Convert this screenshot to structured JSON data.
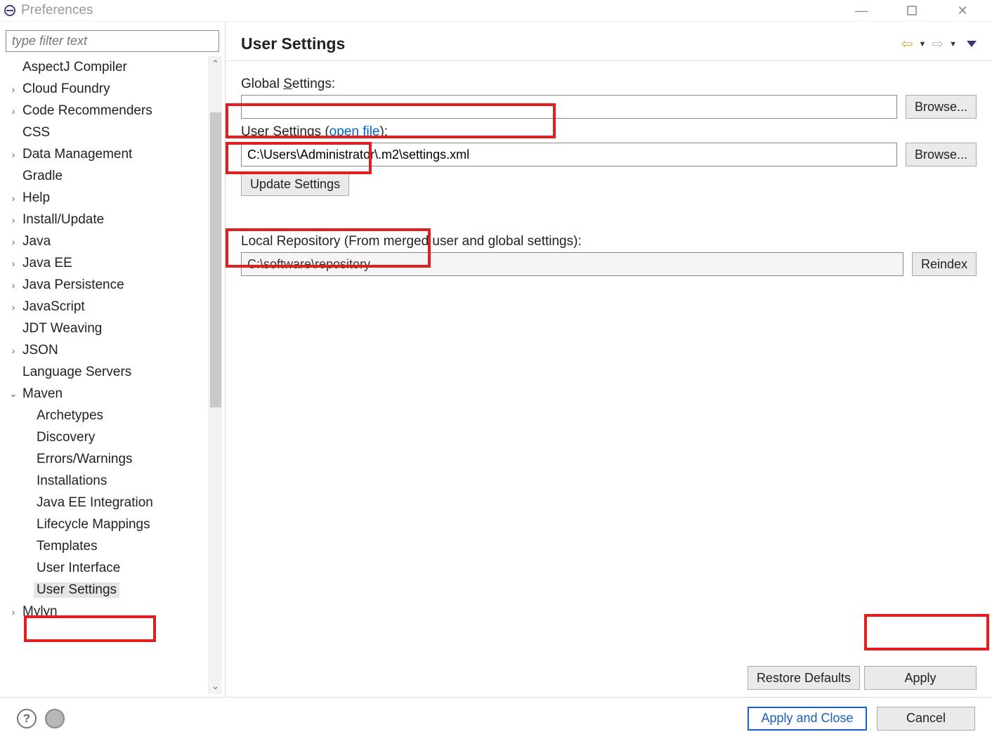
{
  "window": {
    "title": "Preferences"
  },
  "sidebar": {
    "filter_placeholder": "type filter text",
    "items": [
      {
        "label": "AspectJ Compiler",
        "level": 0,
        "arrow": ""
      },
      {
        "label": "Cloud Foundry",
        "level": 0,
        "arrow": ">"
      },
      {
        "label": "Code Recommenders",
        "level": 0,
        "arrow": ">"
      },
      {
        "label": "CSS",
        "level": 0,
        "arrow": ""
      },
      {
        "label": "Data Management",
        "level": 0,
        "arrow": ">"
      },
      {
        "label": "Gradle",
        "level": 0,
        "arrow": ""
      },
      {
        "label": "Help",
        "level": 0,
        "arrow": ">"
      },
      {
        "label": "Install/Update",
        "level": 0,
        "arrow": ">"
      },
      {
        "label": "Java",
        "level": 0,
        "arrow": ">"
      },
      {
        "label": "Java EE",
        "level": 0,
        "arrow": ">"
      },
      {
        "label": "Java Persistence",
        "level": 0,
        "arrow": ">"
      },
      {
        "label": "JavaScript",
        "level": 0,
        "arrow": ">"
      },
      {
        "label": "JDT Weaving",
        "level": 0,
        "arrow": ""
      },
      {
        "label": "JSON",
        "level": 0,
        "arrow": ">"
      },
      {
        "label": "Language Servers",
        "level": 0,
        "arrow": ""
      },
      {
        "label": "Maven",
        "level": 0,
        "arrow": "v"
      },
      {
        "label": "Archetypes",
        "level": 1,
        "arrow": ""
      },
      {
        "label": "Discovery",
        "level": 1,
        "arrow": ""
      },
      {
        "label": "Errors/Warnings",
        "level": 1,
        "arrow": ""
      },
      {
        "label": "Installations",
        "level": 1,
        "arrow": ""
      },
      {
        "label": "Java EE Integration",
        "level": 1,
        "arrow": ""
      },
      {
        "label": "Lifecycle Mappings",
        "level": 1,
        "arrow": ""
      },
      {
        "label": "Templates",
        "level": 1,
        "arrow": ""
      },
      {
        "label": "User Interface",
        "level": 1,
        "arrow": ""
      },
      {
        "label": "User Settings",
        "level": 1,
        "arrow": "",
        "selected": true
      },
      {
        "label": "Mylyn",
        "level": 0,
        "arrow": ">"
      }
    ]
  },
  "content": {
    "title": "User Settings",
    "global_label_pre": "Global ",
    "global_label_mnemonic": "S",
    "global_label_post": "ettings:",
    "global_value": "",
    "browse1": "Browse...",
    "user_label_pre": "User Settings (",
    "user_open_file": "open file",
    "user_label_post": "):",
    "user_value": "C:\\Users\\Administrator\\.m2\\settings.xml",
    "browse2": "Browse...",
    "update_btn": "Update Settings",
    "local_label": "Local Repository (From merged user and global settings):",
    "local_value": "C:\\software\\repository",
    "reindex": "Reindex",
    "restore_defaults": "Restore Defaults",
    "apply": "Apply"
  },
  "footer": {
    "apply_close": "Apply and Close",
    "cancel": "Cancel"
  }
}
